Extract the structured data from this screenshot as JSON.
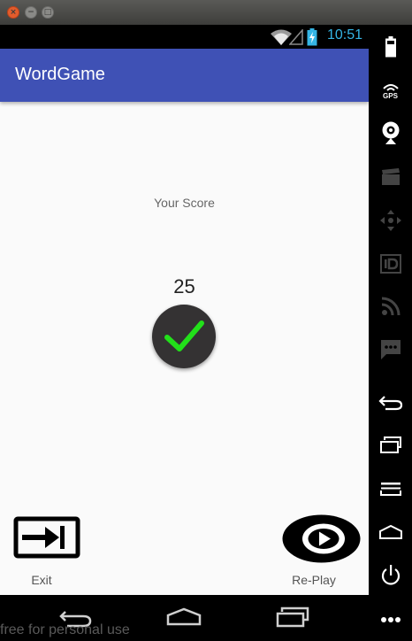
{
  "window": {
    "close_symbol": "×",
    "minimize_symbol": "−",
    "maximize_symbol": "□"
  },
  "status_bar": {
    "time": "10:51",
    "icons": [
      "wifi-icon",
      "signal-icon",
      "battery-charging-icon"
    ],
    "accent_color": "#35b5e5"
  },
  "app_bar": {
    "title": "WordGame",
    "color": "#3f51b5"
  },
  "main": {
    "score_label": "Your Score",
    "score_value": "25",
    "result_icon": "checkmark-icon",
    "check_color": "#22e01a"
  },
  "actions": {
    "exit_label": "Exit",
    "replay_label": "Re-Play"
  },
  "nav_bar": {
    "icons": [
      "back-icon",
      "home-icon",
      "recents-icon"
    ]
  },
  "side_panel": {
    "gps_label": "GPS",
    "icons": [
      "battery-icon",
      "gps-icon",
      "camera-icon",
      "clapper-icon",
      "dpad-icon",
      "id-icon",
      "rss-icon",
      "sms-icon",
      "back-icon",
      "recents-icon",
      "menu-icon",
      "home-icon",
      "power-icon",
      "more-icon"
    ]
  },
  "watermark": "free for personal use"
}
